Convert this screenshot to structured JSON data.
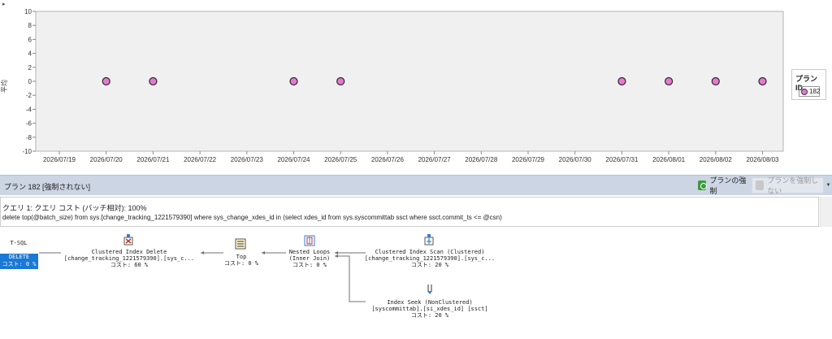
{
  "chart_data": {
    "type": "scatter",
    "title": "",
    "xlabel": "",
    "ylabel": "平均",
    "ylim": [
      -10,
      10
    ],
    "yticks": [
      "10",
      "8",
      "6",
      "4",
      "2",
      "0",
      "-2",
      "-4",
      "-6",
      "-8",
      "-10"
    ],
    "x_categories": [
      "2026/07/19",
      "2026/07/20",
      "2026/07/21",
      "2026/07/22",
      "2026/07/23",
      "2026/07/24",
      "2026/07/25",
      "2026/07/26",
      "2026/07/27",
      "2026/07/28",
      "2026/07/29",
      "2026/07/30",
      "2026/07/31",
      "2026/08/01",
      "2026/08/02",
      "2026/08/03"
    ],
    "grid": false,
    "legend_position": "right",
    "series": [
      {
        "name": "182",
        "color": "#e877d0",
        "points": [
          {
            "x": "2026/07/20",
            "y": 0
          },
          {
            "x": "2026/07/21",
            "y": 0
          },
          {
            "x": "2026/07/24",
            "y": 0
          },
          {
            "x": "2026/07/25",
            "y": 0
          },
          {
            "x": "2026/07/31",
            "y": 0
          },
          {
            "x": "2026/08/01",
            "y": 0
          },
          {
            "x": "2026/08/02",
            "y": 0
          },
          {
            "x": "2026/08/03",
            "y": 0
          }
        ]
      }
    ]
  },
  "legend": {
    "title": "プラン ID",
    "entry": "182"
  },
  "plan_toolbar": {
    "title": "プラン 182 [強制されない]",
    "force_label": "プランの強制",
    "unforce_label": "プランを強制しない"
  },
  "query": {
    "line1": "クエリ 1: クエリ コスト (バッチ相対): 100%",
    "line2": "delete top(@batch_size) from sys.[change_tracking_1221579390] where sys_change_xdes_id in (select xdes_id from sys.syscommittab ssct where ssct.commit_ts <= @csn)"
  },
  "plan": {
    "tsql_label": "T-SQL",
    "delete_op": {
      "line1": "DELETE",
      "line2": "コスト: 0 %"
    },
    "clustered_index_delete": {
      "line1": "Clustered Index Delete",
      "line2": "[change_tracking_1221579390].[sys_c...",
      "line3": "コスト: 60 %"
    },
    "top": {
      "line1": "Top",
      "line2": "コスト: 0 %"
    },
    "nested_loops": {
      "line1": "Nested Loops",
      "line2": "(Inner Join)",
      "line3": "コスト: 0 %"
    },
    "clustered_index_scan": {
      "line1": "Clustered Index Scan (Clustered)",
      "line2": "[change_tracking_1221579390].[sys_c...",
      "line3": "コスト: 20 %"
    },
    "index_seek": {
      "line1": "Index Seek (NonClustered)",
      "line2": "[syscommittab].[si_xdes_id] [ssct]",
      "line3": "コスト: 20 %"
    }
  }
}
